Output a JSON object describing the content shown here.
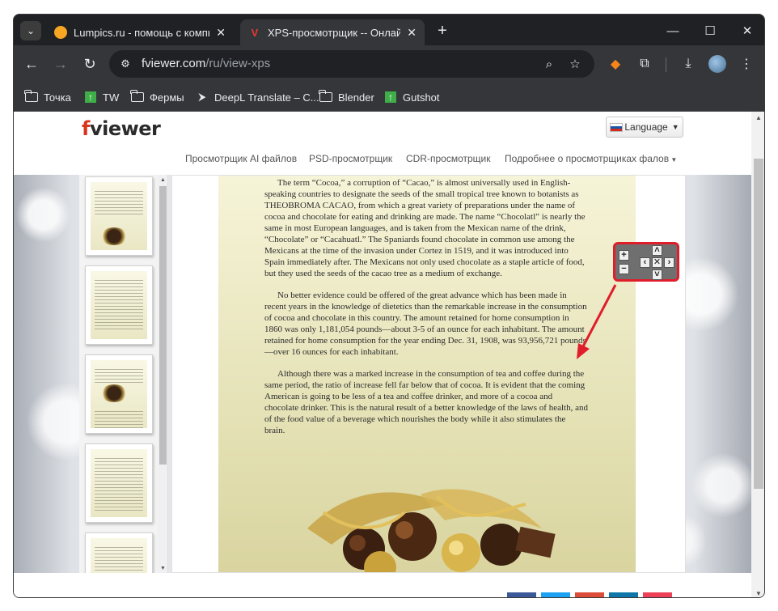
{
  "browser": {
    "tabs": [
      {
        "title": "Lumpics.ru - помощь с компьютером",
        "close": "✕"
      },
      {
        "title": "XPS-просмотрщик -- Онлайн просмотр",
        "close": "✕"
      }
    ],
    "new_tab": "+",
    "window_controls": {
      "minimize": "—",
      "maximize": "☐",
      "close": "✕"
    },
    "url_host": "fviewer.com",
    "url_path": "/ru/view-xps",
    "bookmarks": [
      "Точка",
      "TW",
      "Фермы",
      "DeepL Translate – С...",
      "Blender",
      "Gutshot"
    ]
  },
  "site": {
    "logo_f": "f",
    "logo_rest": "viewer",
    "language_button": "Language",
    "nav_links": [
      "Просмотрщик AI файлов",
      "PSD-просмотрщик",
      "CDR-просмотрщик",
      "Подробнее о просмотрщиках фалов"
    ]
  },
  "document": {
    "paragraphs": [
      "The term “Cocoa,” a corruption of “Cacao,” is almost universally used in English-speaking countries to designate the seeds of the small tropical tree known to botanists as THEOBROMA CACAO, from which a great variety of preparations under the name of cocoa and chocolate for eating and drinking are made. The name “Chocolatl” is nearly the same in most European languages, and is taken from the Mexican name of the drink, “Chocolate” or “Cacahuatl.” The Spaniards found chocolate in common use among the Mexicans at the time of the invasion under Cortez in 1519, and it was introduced into Spain immediately after. The Mexicans not only used chocolate as a staple article of food, but they used the seeds of the cacao tree as a medium of exchange.",
      "No better evidence could be offered of the great advance which has been made in recent years in the knowledge of dietetics than the remarkable increase in the consumption of cocoa and chocolate in this country. The amount retained for home consumption in 1860 was only 1,181,054 pounds—about 3-5 of an ounce for each inhabitant. The amount retained for home consumption for the year ending Dec. 31, 1908, was 93,956,721 pounds—over 16 ounces for each inhabitant.",
      "Although there was a marked increase in the consumption of tea and coffee during the same period, the ratio of increase fell far below that of cocoa. It is evident that the coming American is going to be less of a tea and coffee drinker, and more of a cocoa and chocolate drinker. This is the natural result of a better knowledge of the laws of health, and of the food value of a beverage which nourishes the body while it also stimulates the brain."
    ]
  },
  "zoom_controls": {
    "zoom_in": "+",
    "zoom_out": "−",
    "up": "˄",
    "down": "˅",
    "left": "‹",
    "right": "›",
    "reset": "✕"
  },
  "colors": {
    "highlight": "#e01e2b",
    "accent_red": "#d9341d"
  }
}
